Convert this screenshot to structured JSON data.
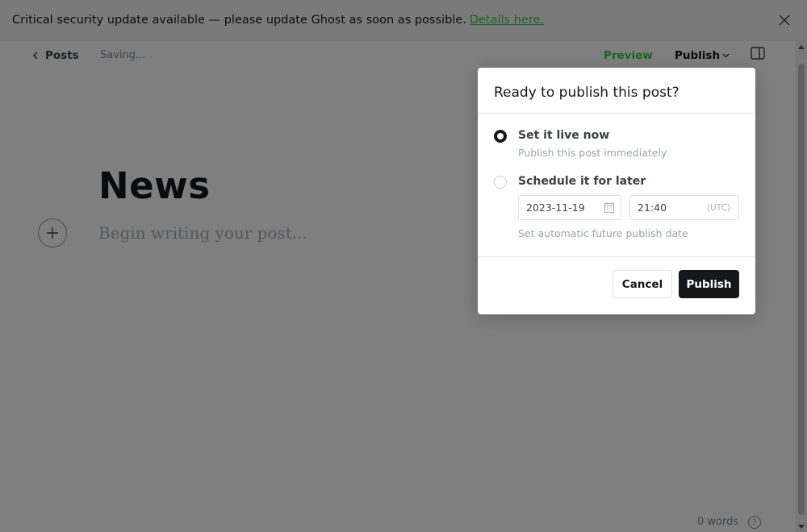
{
  "banner": {
    "message": "Critical security update available — please update Ghost as soon as possible.",
    "link_label": "Details here."
  },
  "header": {
    "back_label": "Posts",
    "status": "Saving...",
    "preview_label": "Preview",
    "publish_label": "Publish"
  },
  "editor": {
    "title": "News",
    "body_placeholder": "Begin writing your post..."
  },
  "footer": {
    "word_count": "0 words",
    "help_label": "?"
  },
  "modal": {
    "title": "Ready to publish this post?",
    "options": [
      {
        "label": "Set it live now",
        "description": "Publish this post immediately",
        "selected": true
      },
      {
        "label": "Schedule it for later",
        "description": "Set automatic future publish date",
        "selected": false
      }
    ],
    "schedule": {
      "date": "2023-11-19",
      "time": "21:40",
      "timezone": "(UTC)"
    },
    "cancel_label": "Cancel",
    "publish_label": "Publish"
  },
  "colors": {
    "accent_green": "#30cf43",
    "dark": "#15171a",
    "overlay": "rgba(0,0,0,0.5)"
  }
}
